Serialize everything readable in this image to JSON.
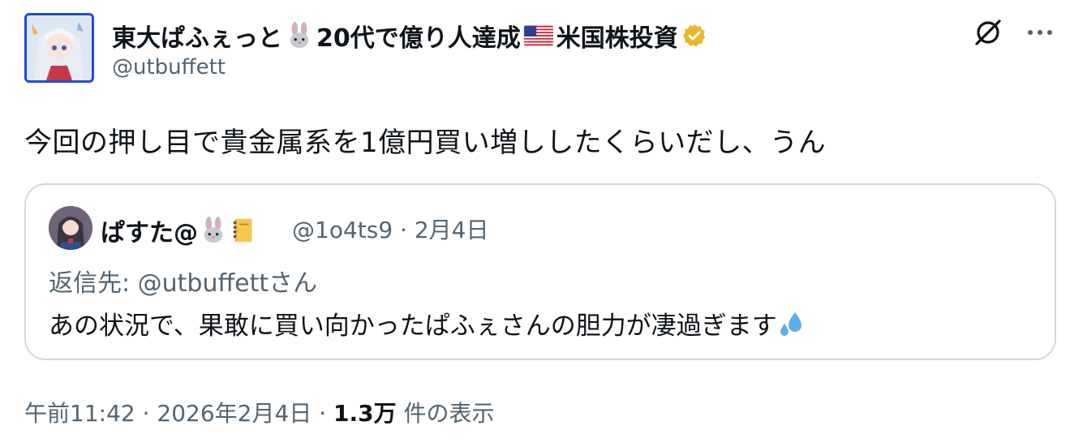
{
  "author": {
    "display_name_part1": "東大ぱふぇっと",
    "display_name_part2": "20代で億り人達成",
    "display_name_part3": "米国株投資",
    "handle": "@utbuffett"
  },
  "icons": {
    "grok": "grok-icon",
    "more": "more-dots-icon",
    "verified": "verified-badge-icon",
    "bunny": "rabbit-emoji-icon",
    "flag": "us-flag-emoji-icon",
    "notebook": "notebook-emoji-icon",
    "sweat": "sweat-droplets-emoji-icon"
  },
  "tweet": {
    "text": "今回の押し目で貴金属系を1億円買い増ししたくらいだし、うん"
  },
  "quote": {
    "name": "ぱすた@",
    "handle": "@1o4ts9",
    "separator": "·",
    "date": "2月4日",
    "reply_to": "返信先: @utbuffettさん",
    "text": "あの状況で、果敢に買い向かったぱふぇさんの胆力が凄過ぎます"
  },
  "footer": {
    "time": "午前11:42",
    "dot1": "·",
    "date": "2026年2月4日",
    "dot2": "·",
    "views": "1.3万",
    "views_label": "件の表示"
  },
  "colors": {
    "text": "#0f1419",
    "secondary": "#536471",
    "border": "#cfd9de",
    "verified_gold": "#e8b829"
  }
}
